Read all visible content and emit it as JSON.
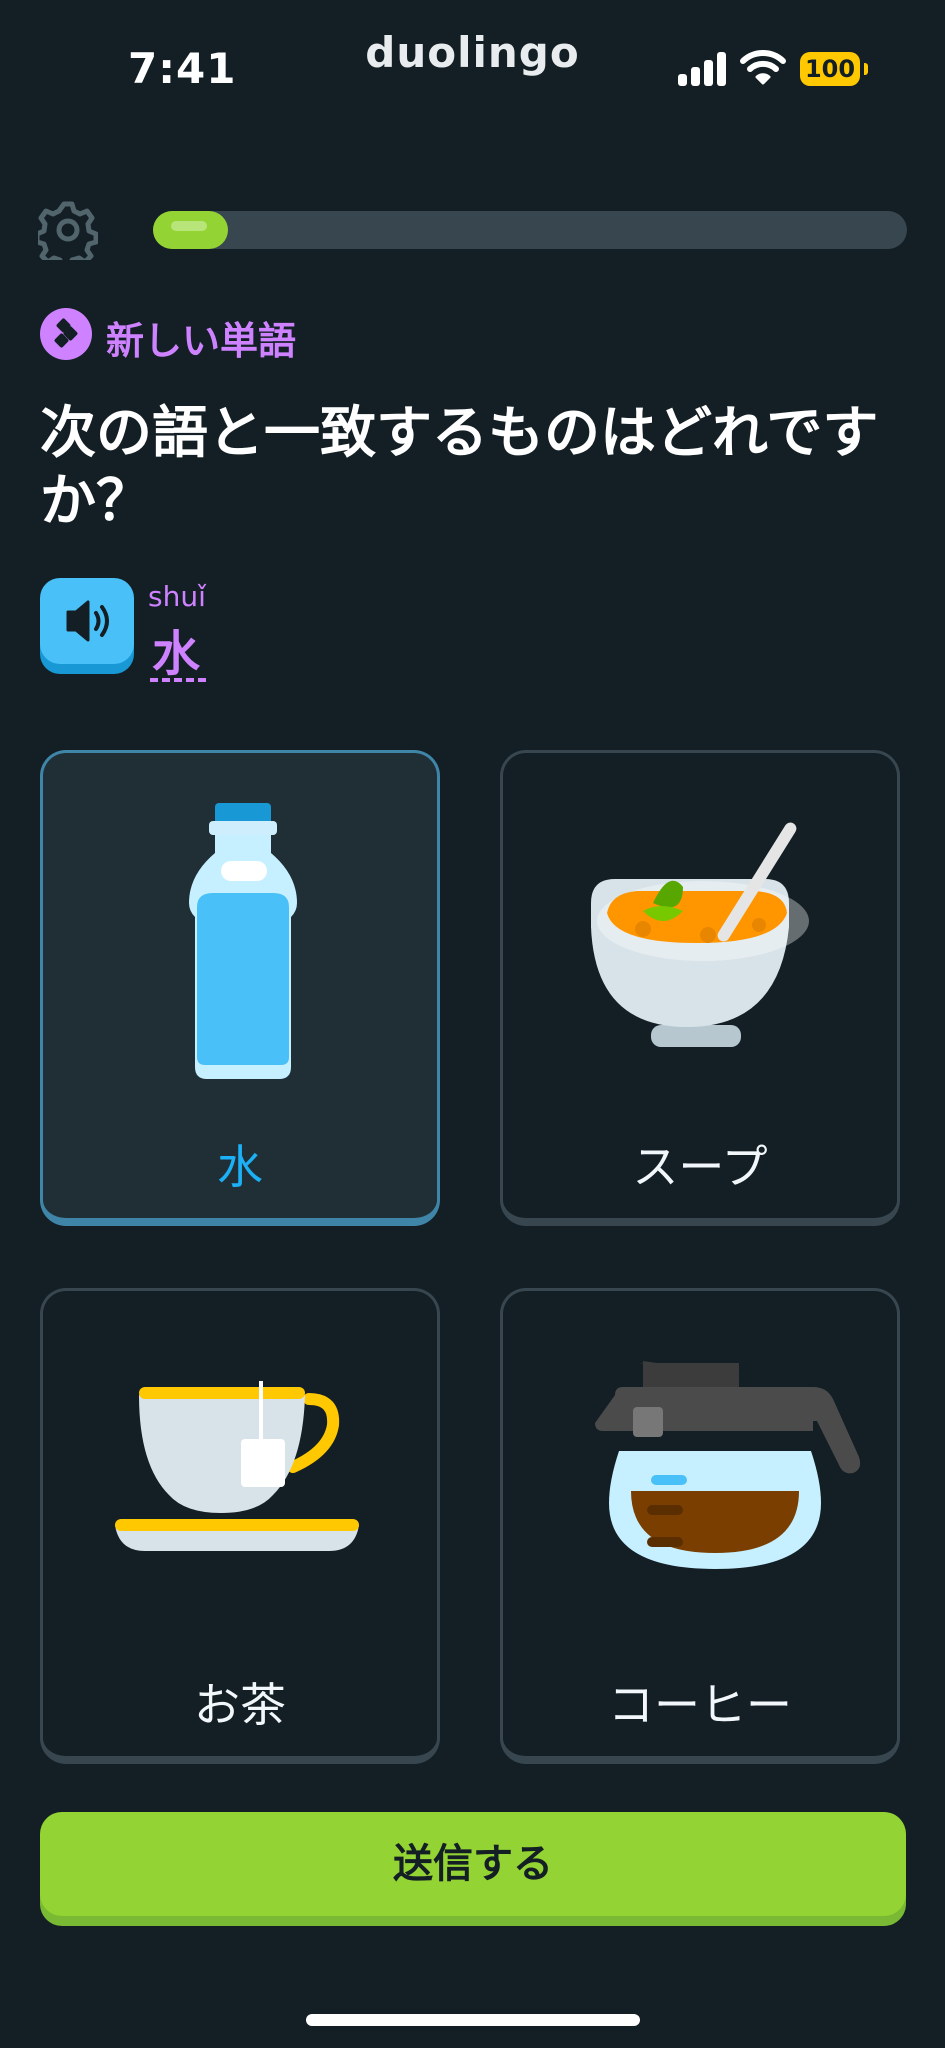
{
  "status_bar": {
    "time": "7:41",
    "battery": "100",
    "app_name": "duolingo"
  },
  "progress": {
    "fraction": 0.1
  },
  "lesson": {
    "tag_label": "新しい単語",
    "question": "次の語と一致するものはどれですか？",
    "prompt": {
      "pinyin": "shuǐ",
      "hanzi": "水"
    }
  },
  "choices": [
    {
      "label": "水",
      "icon": "water-bottle-icon",
      "selected": true
    },
    {
      "label": "スープ",
      "icon": "soup-bowl-icon",
      "selected": false
    },
    {
      "label": "お茶",
      "icon": "tea-cup-icon",
      "selected": false
    },
    {
      "label": "コーヒー",
      "icon": "coffee-pot-icon",
      "selected": false
    }
  ],
  "submit_label": "送信する",
  "colors": {
    "background": "#131f24",
    "accent_green": "#93d333",
    "accent_purple": "#ce82ff",
    "accent_blue": "#1cb0f6",
    "battery_yellow": "#ffc800"
  }
}
